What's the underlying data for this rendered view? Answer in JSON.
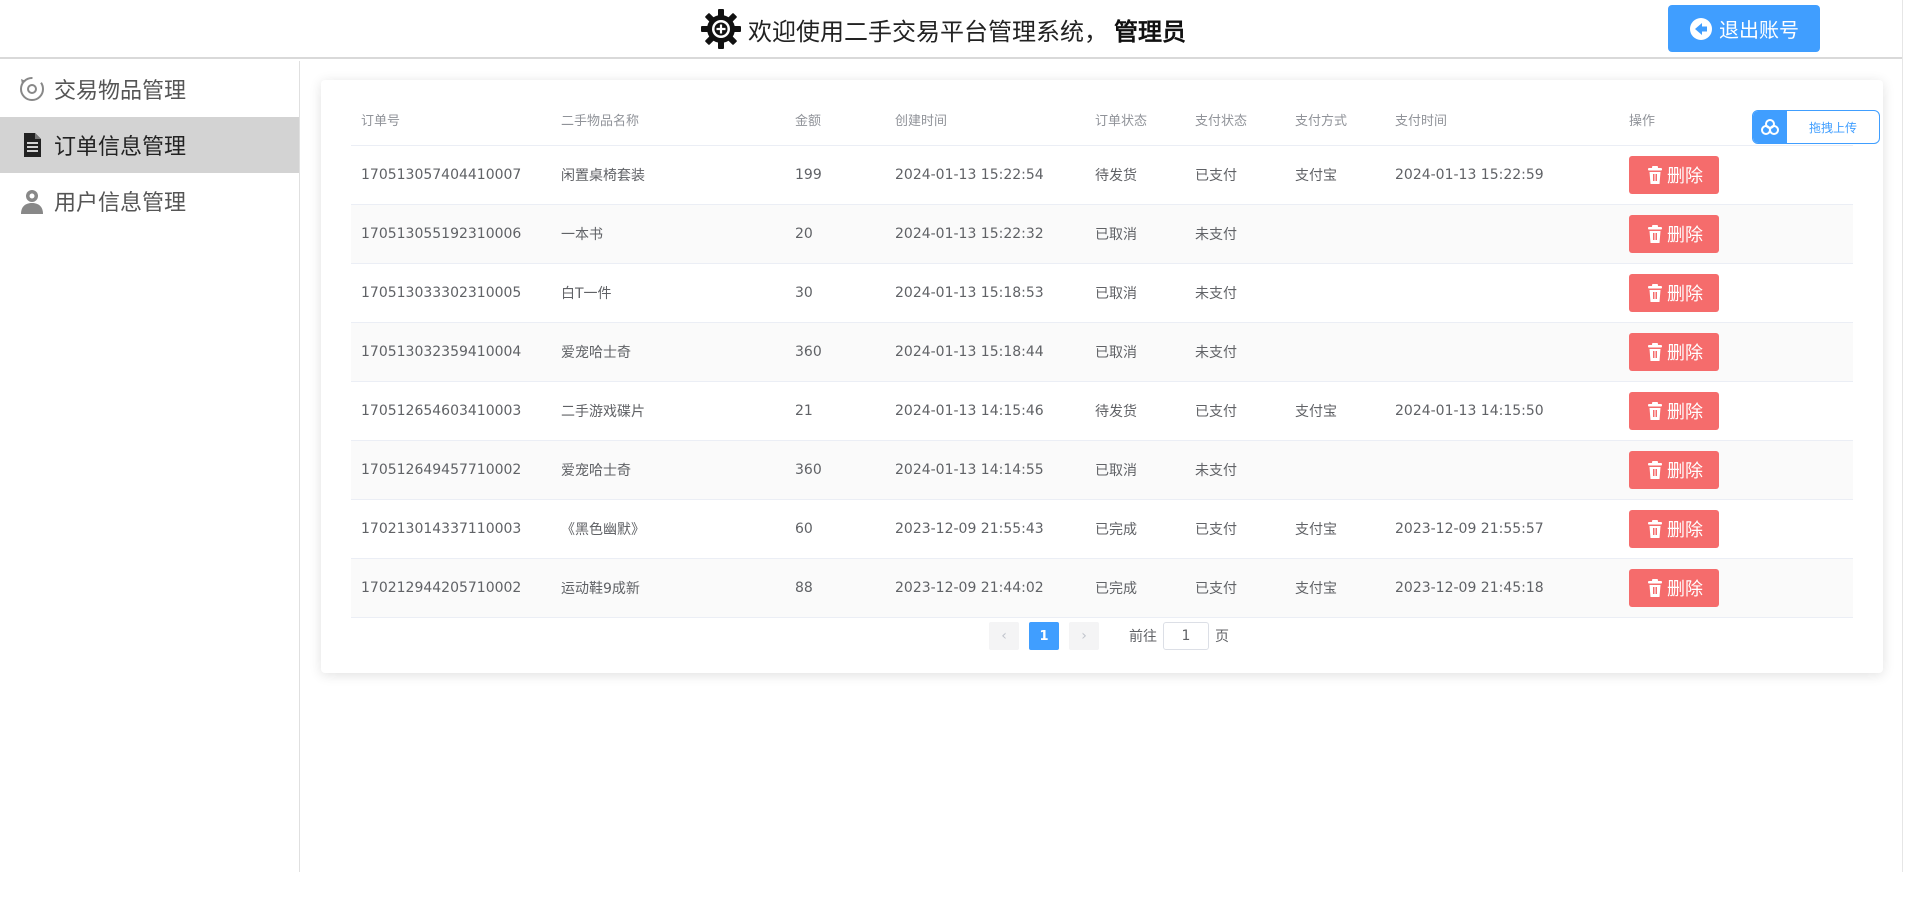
{
  "header": {
    "title_prefix": "欢迎使用二手交易平台管理系统，",
    "admin_name": "管理员",
    "logout_label": "退出账号"
  },
  "sidebar": {
    "items": [
      {
        "label": "交易物品管理",
        "icon": "exchange-icon",
        "active": false
      },
      {
        "label": "订单信息管理",
        "icon": "document-icon",
        "active": true
      },
      {
        "label": "用户信息管理",
        "icon": "user-icon",
        "active": false
      }
    ]
  },
  "table": {
    "columns": [
      "订单号",
      "二手物品名称",
      "金额",
      "创建时间",
      "订单状态",
      "支付状态",
      "支付方式",
      "支付时间",
      "操作"
    ],
    "rows": [
      {
        "order_no": "170513057404410007",
        "item": "闲置桌椅套装",
        "amount": "199",
        "created": "2024-01-13 15:22:54",
        "order_status": "待发货",
        "pay_status": "已支付",
        "pay_method": "支付宝",
        "pay_time": "2024-01-13 15:22:59"
      },
      {
        "order_no": "170513055192310006",
        "item": "一本书",
        "amount": "20",
        "created": "2024-01-13 15:22:32",
        "order_status": "已取消",
        "pay_status": "未支付",
        "pay_method": "",
        "pay_time": ""
      },
      {
        "order_no": "170513033302310005",
        "item": "白T一件",
        "amount": "30",
        "created": "2024-01-13 15:18:53",
        "order_status": "已取消",
        "pay_status": "未支付",
        "pay_method": "",
        "pay_time": ""
      },
      {
        "order_no": "170513032359410004",
        "item": "爱宠哈士奇",
        "amount": "360",
        "created": "2024-01-13 15:18:44",
        "order_status": "已取消",
        "pay_status": "未支付",
        "pay_method": "",
        "pay_time": ""
      },
      {
        "order_no": "170512654603410003",
        "item": "二手游戏碟片",
        "amount": "21",
        "created": "2024-01-13 14:15:46",
        "order_status": "待发货",
        "pay_status": "已支付",
        "pay_method": "支付宝",
        "pay_time": "2024-01-13 14:15:50"
      },
      {
        "order_no": "170512649457710002",
        "item": "爱宠哈士奇",
        "amount": "360",
        "created": "2024-01-13 14:14:55",
        "order_status": "已取消",
        "pay_status": "未支付",
        "pay_method": "",
        "pay_time": ""
      },
      {
        "order_no": "170213014337110003",
        "item": "《黑色幽默》",
        "amount": "60",
        "created": "2023-12-09 21:55:43",
        "order_status": "已完成",
        "pay_status": "已支付",
        "pay_method": "支付宝",
        "pay_time": "2023-12-09 21:55:57"
      },
      {
        "order_no": "170212944205710002",
        "item": "运动鞋9成新",
        "amount": "88",
        "created": "2023-12-09 21:44:02",
        "order_status": "已完成",
        "pay_status": "已支付",
        "pay_method": "支付宝",
        "pay_time": "2023-12-09 21:45:18"
      }
    ],
    "delete_label": "删除"
  },
  "pagination": {
    "current_page": "1",
    "goto_prefix": "前往",
    "goto_value": "1",
    "goto_suffix": "页"
  },
  "upload": {
    "label": "拖拽上传"
  },
  "colors": {
    "primary": "#409eff",
    "danger": "#f56c6c",
    "active_menu": "#d3d3d3"
  }
}
